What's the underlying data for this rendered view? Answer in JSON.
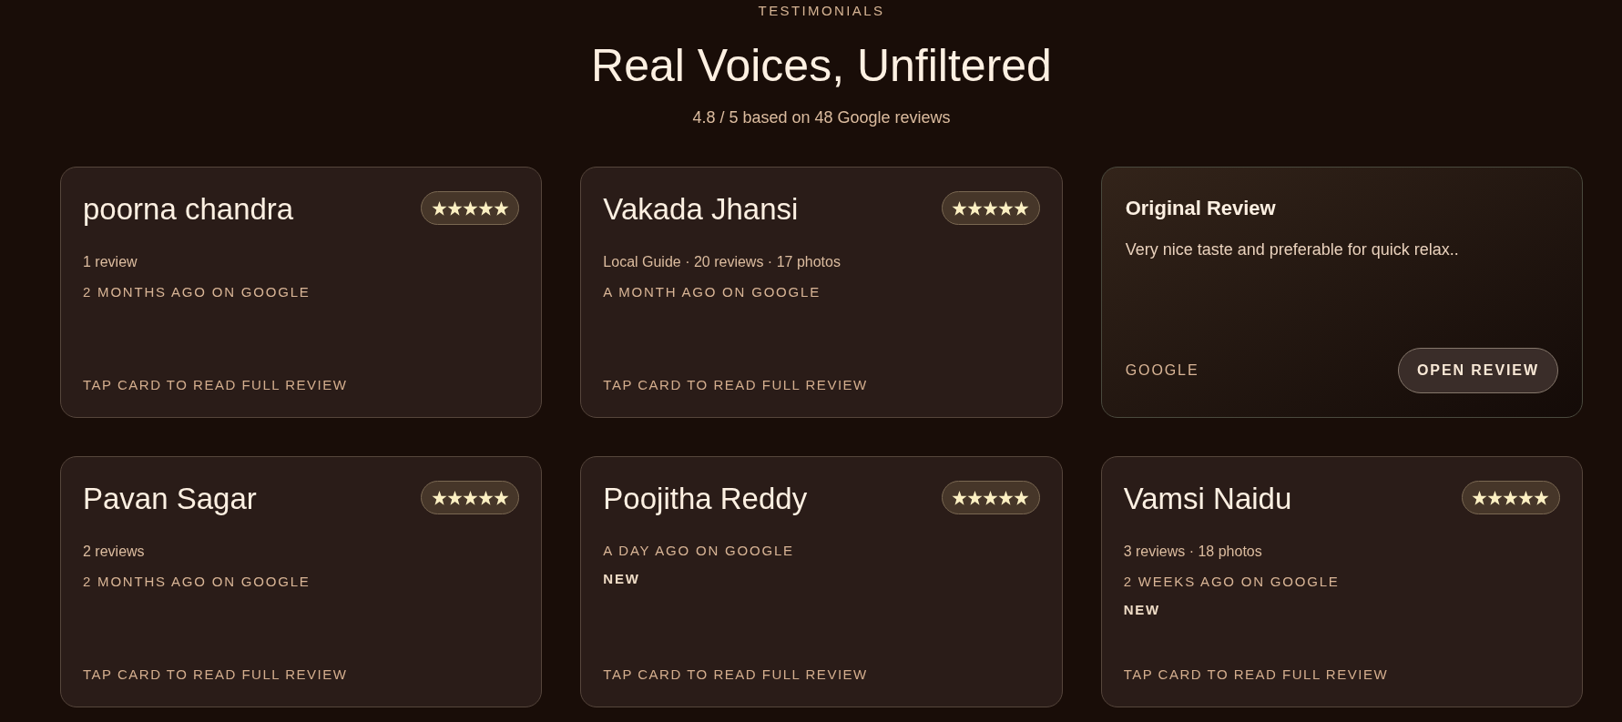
{
  "section": {
    "eyebrow": "TESTIMONIALS",
    "title": "Real Voices, Unfiltered",
    "summary": "4.8 / 5 based on 48 Google reviews"
  },
  "cards": [
    {
      "kind": "review",
      "name": "poorna chandra",
      "stars": 5,
      "profile": "1 review",
      "time": "2 MONTHS AGO ON GOOGLE",
      "hint": "TAP CARD TO READ FULL REVIEW"
    },
    {
      "kind": "review",
      "name": "Vakada Jhansi",
      "stars": 5,
      "profile": "Local Guide · 20 reviews · 17 photos",
      "time": "A MONTH AGO ON GOOGLE",
      "hint": "TAP CARD TO READ FULL REVIEW"
    },
    {
      "kind": "flipped",
      "heading": "Original Review",
      "text": "Very nice taste and preferable for quick relax..",
      "source": "GOOGLE",
      "button": "OPEN REVIEW"
    },
    {
      "kind": "review",
      "name": "Pavan Sagar",
      "stars": 5,
      "profile": "2 reviews",
      "time": "2 MONTHS AGO ON GOOGLE",
      "hint": "TAP CARD TO READ FULL REVIEW"
    },
    {
      "kind": "review",
      "name": "Poojitha Reddy",
      "stars": 5,
      "time": "A DAY AGO ON GOOGLE",
      "badge": "NEW",
      "hint": "TAP CARD TO READ FULL REVIEW"
    },
    {
      "kind": "review",
      "name": "Vamsi Naidu",
      "stars": 5,
      "profile": "3 reviews · 18 photos",
      "time": "2 WEEKS AGO ON GOOGLE",
      "badge": "NEW",
      "hint": "TAP CARD TO READ FULL REVIEW"
    }
  ]
}
